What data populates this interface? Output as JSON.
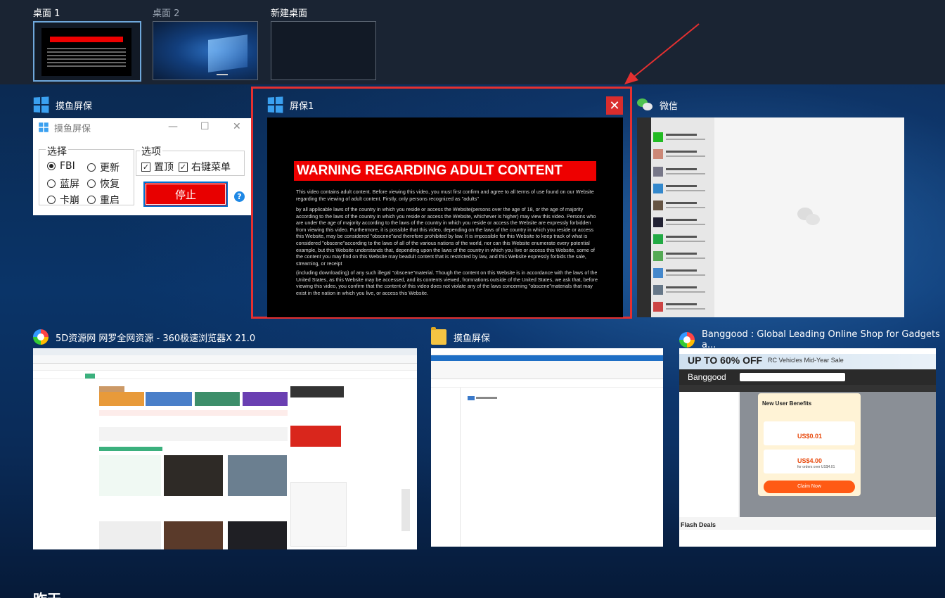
{
  "desktops": [
    {
      "label": "桌面 1",
      "active": true
    },
    {
      "label": "桌面 2",
      "active": false
    },
    {
      "label": "新建桌面",
      "active": false
    }
  ],
  "windows": {
    "moyu": {
      "card_title": "摸鱼屏保",
      "window_title": "摸鱼屏保",
      "group_choose": "选择",
      "group_options": "选项",
      "radios": [
        "FBI",
        "更新",
        "蓝屏",
        "恢复",
        "卡崩",
        "重启"
      ],
      "selected_radio": "FBI",
      "checks": [
        "置顶",
        "右键菜单"
      ],
      "stop_label": "停止",
      "help_label": "?"
    },
    "screensaver": {
      "card_title": "屏保1",
      "close_label": "✕",
      "warning_title": "WARNING REGARDING ADULT CONTENT",
      "paragraphs": [
        "This video contains adult content. Before viewing this video, you must first confirm and agree to all terms of use found on our Website regarding the viewing of adult content. Firstly, only persons recognized as \"adults\"",
        "by all applicable laws of the country in which you reside or access the Website(persons over the age of 18, or the age of majority according to the laws of the country in which you reside or access the Website, whichever is higher) may view this video. Persons who are under the age of majority according to the laws of the country in which you reside or access the Website are expressly forbidden from viewing this video. Furthermore, it is possible that this video, depending on the laws of the country in which you reside or access this Website, may be considered \"obscene\"and therefore prohibited by law. It is impossible for this Website to keep track of what is considered \"obscene\"according to the laws of all of the various nations of the world, nor can this Website enumerate every potential example, but this Website understands that, depending upon the laws of the country in which you live or access this Website, some of the content you may find on this Website may beadult content that is restricted by law, and this Website expressly forbids the sale, streaming, or receipt",
        "(including downloading) of any such illegal \"obscene\"material. Though the content on this Website is in accordance with the laws of the United States, as this Website may be accessed, and its contents viewed, fromnations outside of the United States, we ask that, before viewing this video, you confirm that the content of this video does not violate any of the laws concerning \"obscene\"materials that may exist in the nation in which you live, or access this Website."
      ]
    },
    "wechat": {
      "card_title": "微信"
    },
    "browser360": {
      "card_title": "5D资源网 网罗全网资源 - 360极速浏览器X 21.0"
    },
    "explorer": {
      "card_title": "摸鱼屏保"
    },
    "banggood": {
      "card_title": "Banggood : Global Leading Online Shop for Gadgets a...",
      "banner": "UP TO 60% OFF",
      "banner_sub": "RC Vehicles Mid-Year Sale",
      "brand": "Banggood",
      "popup_title": "New User Benefits",
      "coupon1": "US$0.01",
      "coupon2": "US$4.00",
      "coupon2_sub": "for orders over US$4.01",
      "claim": "Claim Now",
      "flash": "Flash Deals"
    }
  },
  "section_yesterday": "昨天",
  "colors": {
    "highlight": "#e53030",
    "stop_button": "#e80000",
    "accent": "#3aa0f0"
  }
}
